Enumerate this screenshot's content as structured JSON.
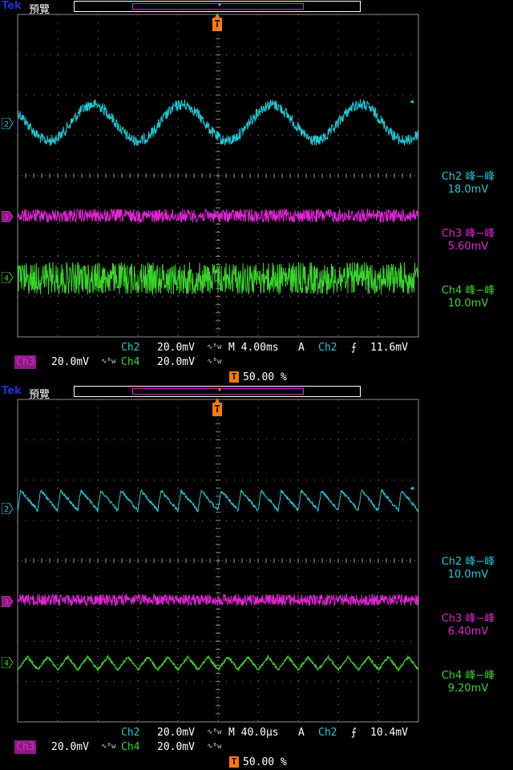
{
  "panels": [
    {
      "brand": "Tek",
      "status": "預覽",
      "trigger_marker": "T",
      "measurements": [
        {
          "label": "Ch2 峰−峰",
          "value": "18.0mV"
        },
        {
          "label": "Ch3 峰−峰",
          "value": "5.60mV"
        },
        {
          "label": "Ch4 峰−峰",
          "value": "10.0mV"
        }
      ],
      "ch2_scale": "Ch2",
      "ch2_volts": "20.0mV",
      "ch3_scale": "Ch3",
      "ch3_volts": "20.0mV",
      "ch4_scale": "Ch4",
      "ch4_volts": "20.0mV",
      "bw_icon": "∿ᴮw",
      "timebase": "M 4.00ms",
      "trig_mode": "A",
      "trig_source": "Ch2",
      "trig_slope": "⨍",
      "trig_level": "11.6mV",
      "trig_pos": "50.00 %",
      "channel_markers": [
        "2",
        "3",
        "4"
      ]
    },
    {
      "brand": "Tek",
      "status": "預覽",
      "trigger_marker": "T",
      "measurements": [
        {
          "label": "Ch2 峰−峰",
          "value": "10.0mV"
        },
        {
          "label": "Ch3 峰−峰",
          "value": "6.40mV"
        },
        {
          "label": "Ch4 峰−峰",
          "value": "9.20mV"
        }
      ],
      "ch2_scale": "Ch2",
      "ch2_volts": "20.0mV",
      "ch3_scale": "Ch3",
      "ch3_volts": "20.0mV",
      "ch4_scale": "Ch4",
      "ch4_volts": "20.0mV",
      "bw_icon": "∿ᴮw",
      "timebase": "M 40.0µs",
      "trig_mode": "A",
      "trig_source": "Ch2",
      "trig_slope": "⨍",
      "trig_level": "10.4mV",
      "trig_pos": "50.00 %",
      "channel_markers": [
        "2",
        "3",
        "4"
      ]
    }
  ],
  "colors": {
    "ch2": "#1ec8d6",
    "ch3": "#e224d6",
    "ch4": "#3ad42c",
    "grid": "#8c8c8c",
    "trigger": "#ff7a00"
  },
  "chart_data": [
    {
      "type": "line",
      "series": [
        {
          "name": "Ch2",
          "cycles": 4.5,
          "peak_to_peak_mV": 18.0,
          "shape": "sine"
        },
        {
          "name": "Ch3",
          "peak_to_peak_mV": 5.6,
          "shape": "noise"
        },
        {
          "name": "Ch4",
          "peak_to_peak_mV": 10.0,
          "shape": "noise"
        }
      ],
      "timebase": "4.00ms/div"
    },
    {
      "type": "line",
      "series": [
        {
          "name": "Ch2",
          "cycles": 20,
          "peak_to_peak_mV": 10.0,
          "shape": "sawtooth"
        },
        {
          "name": "Ch3",
          "peak_to_peak_mV": 6.4,
          "shape": "noise"
        },
        {
          "name": "Ch4",
          "peak_to_peak_mV": 9.2,
          "shape": "triangle"
        }
      ],
      "timebase": "40.0µs/div"
    }
  ]
}
